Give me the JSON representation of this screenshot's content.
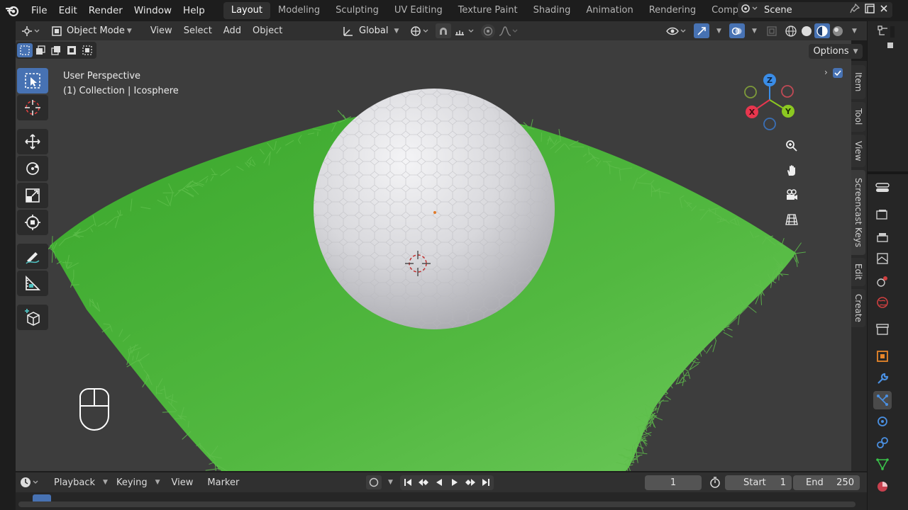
{
  "menu": [
    "File",
    "Edit",
    "Render",
    "Window",
    "Help"
  ],
  "workspaces": [
    "Layout",
    "Modeling",
    "Sculpting",
    "UV Editing",
    "Texture Paint",
    "Shading",
    "Animation",
    "Rendering",
    "Compositing"
  ],
  "active_workspace": "Layout",
  "scene": {
    "name": "Scene"
  },
  "viewport_header": {
    "mode": "Object Mode",
    "menus": [
      "View",
      "Select",
      "Add",
      "Object"
    ],
    "transform_orientation": "Global"
  },
  "options_label": "Options",
  "viewport_info": {
    "perspective": "User Perspective",
    "collection": "(1) Collection | Icosphere"
  },
  "gizmo_axes": [
    "Z",
    "Y",
    "X"
  ],
  "n_panel_tabs": [
    "Item",
    "Tool",
    "View",
    "Screencast Keys",
    "Edit",
    "Create"
  ],
  "timeline": {
    "menus": [
      "Playback",
      "Keying",
      "View",
      "Marker"
    ],
    "current_frame": "1",
    "start_label": "Start",
    "start": "1",
    "end_label": "End",
    "end": "250"
  },
  "icons": {
    "tools": [
      "select-box-icon",
      "cursor-icon",
      "move-icon",
      "rotate-icon",
      "scale-icon",
      "transform-icon",
      "annotate-icon",
      "measure-icon",
      "add-cube-icon"
    ],
    "navigation": [
      "zoom-icon",
      "pan-hand-icon",
      "camera-icon",
      "grid-icon"
    ]
  },
  "colors": {
    "accent": "#4772b3",
    "grass": "#4cae3a",
    "axis_x": "#e8364e",
    "axis_y": "#8cc821",
    "axis_z": "#3a8de8"
  }
}
